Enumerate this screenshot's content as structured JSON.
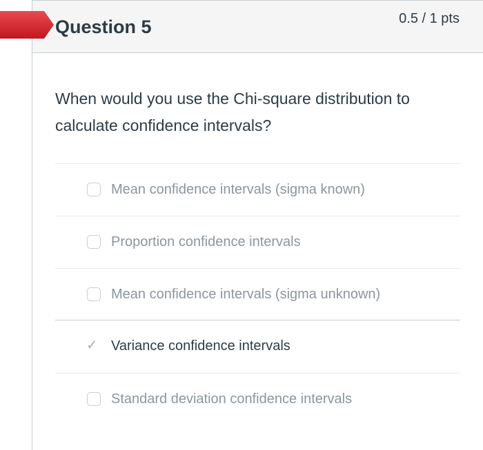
{
  "question": {
    "title": "Question 5",
    "points": "0.5 / 1 pts",
    "text": "When would you use the Chi-square distribution to calculate confidence intervals?"
  },
  "answers": [
    {
      "label": "Mean confidence intervals (sigma known)",
      "selected": false
    },
    {
      "label": "Proportion confidence intervals",
      "selected": false
    },
    {
      "label": "Mean confidence intervals (sigma unknown)",
      "selected": false
    },
    {
      "label": "Variance confidence intervals",
      "selected": true
    },
    {
      "label": "Standard deviation confidence intervals",
      "selected": false
    }
  ],
  "colors": {
    "flag_red": "#d0202b",
    "text_dark": "#2d3b45",
    "text_muted": "#8b969e",
    "header_bg": "#f5f5f5",
    "border": "#c7cdd1"
  },
  "icons": {
    "flag": "question-flag-icon",
    "selected": "checkmark-icon",
    "unselected": "checkbox-icon"
  }
}
